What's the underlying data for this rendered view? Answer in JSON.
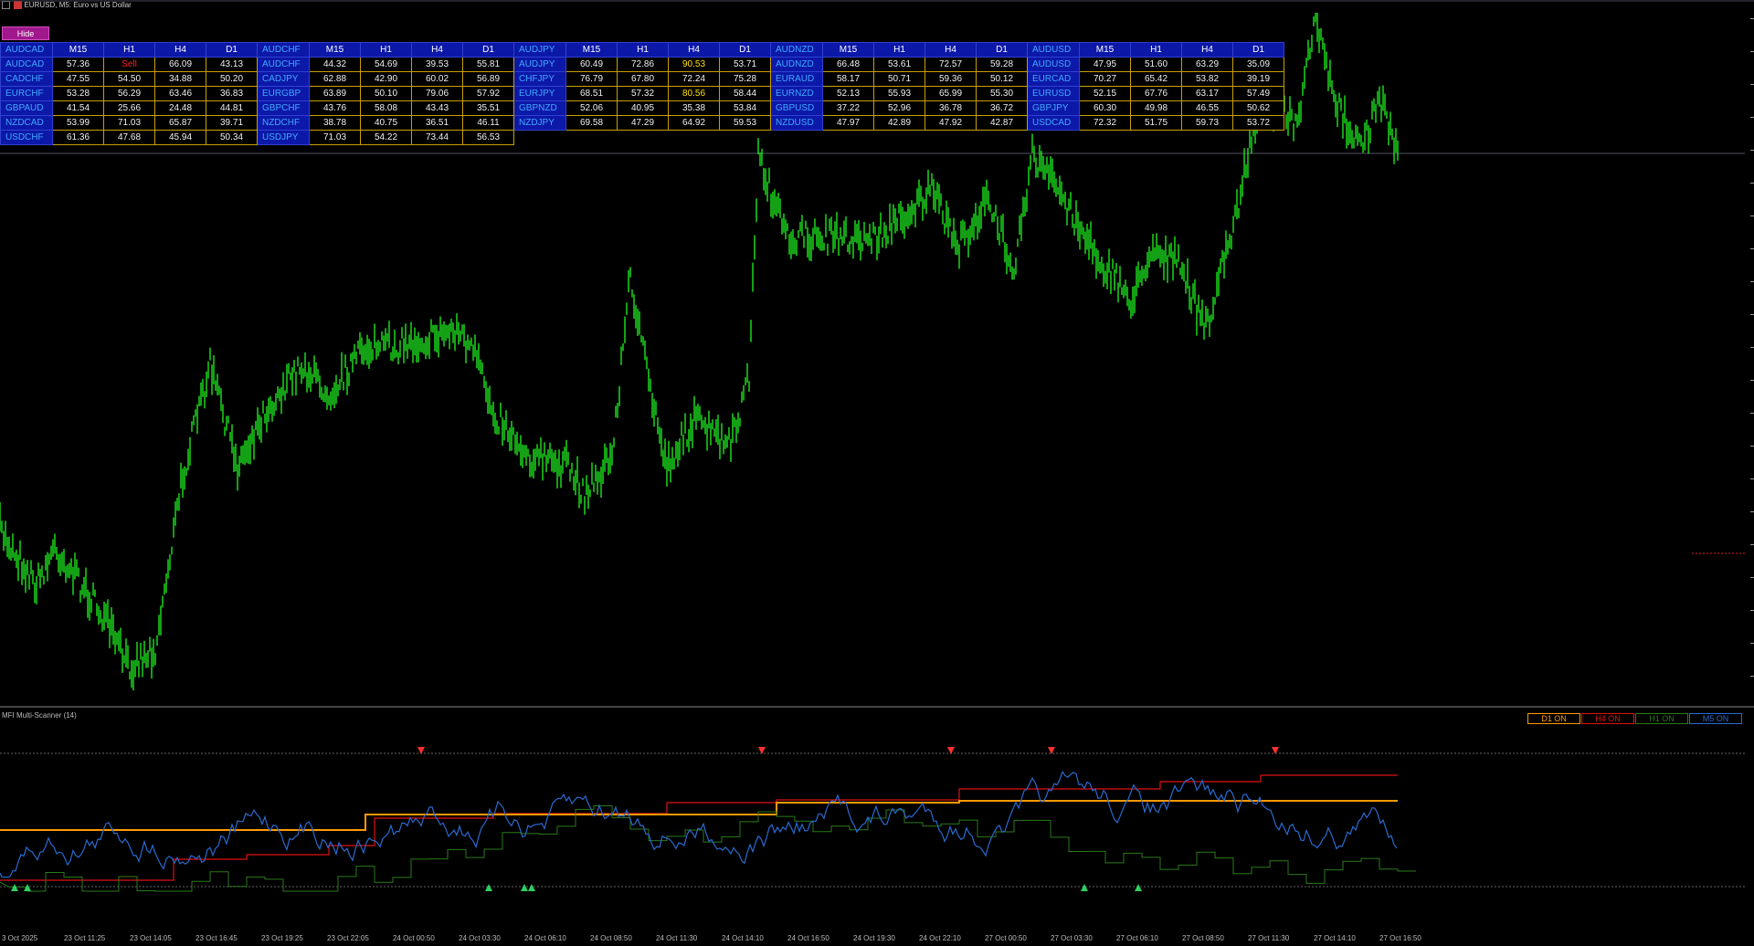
{
  "window": {
    "title": "EURUSD, M5:  Euro vs US Dollar"
  },
  "hide_button": {
    "label": "Hide"
  },
  "scanner": {
    "header_row": [
      [
        "AUDCAD",
        "M15",
        "H1",
        "H4",
        "D1"
      ],
      [
        "AUDCHF",
        "M15",
        "H1",
        "H4",
        "D1"
      ],
      [
        "AUDJPY",
        "M15",
        "H1",
        "H4",
        "D1"
      ],
      [
        "AUDNZD",
        "M15",
        "H1",
        "H4",
        "D1"
      ],
      [
        "AUDUSD",
        "M15",
        "H1",
        "H4",
        "D1"
      ]
    ],
    "rows": [
      [
        [
          "AUDCAD",
          "57.36",
          "Sell",
          "66.09",
          "43.13"
        ],
        [
          "AUDCHF",
          "44.32",
          "54.69",
          "39.53",
          "55.81"
        ],
        [
          "AUDJPY",
          "60.49",
          "72.86",
          "90.53",
          "53.71"
        ],
        [
          "AUDNZD",
          "66.48",
          "53.61",
          "72.57",
          "59.28"
        ],
        [
          "AUDUSD",
          "47.95",
          "51.60",
          "63.29",
          "35.09"
        ]
      ],
      [
        [
          "CADCHF",
          "47.55",
          "54.50",
          "34.88",
          "50.20"
        ],
        [
          "CADJPY",
          "62.88",
          "42.90",
          "60.02",
          "56.89"
        ],
        [
          "CHFJPY",
          "76.79",
          "67.80",
          "72.24",
          "75.28"
        ],
        [
          "EURAUD",
          "58.17",
          "50.71",
          "59.36",
          "50.12"
        ],
        [
          "EURCAD",
          "70.27",
          "65.42",
          "53.82",
          "39.19"
        ]
      ],
      [
        [
          "EURCHF",
          "53.28",
          "56.29",
          "63.46",
          "36.83"
        ],
        [
          "EURGBP",
          "63.89",
          "50.10",
          "79.06",
          "57.92"
        ],
        [
          "EURJPY",
          "68.51",
          "57.32",
          "80.56",
          "58.44"
        ],
        [
          "EURNZD",
          "52.13",
          "55.93",
          "65.99",
          "55.30"
        ],
        [
          "EURUSD",
          "52.15",
          "67.76",
          "63.17",
          "57.49"
        ]
      ],
      [
        [
          "GBPAUD",
          "41.54",
          "25.66",
          "24.48",
          "44.81"
        ],
        [
          "GBPCHF",
          "43.76",
          "58.08",
          "43.43",
          "35.51"
        ],
        [
          "GBPNZD",
          "52.06",
          "40.95",
          "35.38",
          "53.84"
        ],
        [
          "GBPUSD",
          "37.22",
          "52.96",
          "36.78",
          "36.72"
        ],
        [
          "GBPJPY",
          "60.30",
          "49.98",
          "46.55",
          "50.62"
        ]
      ],
      [
        [
          "NZDCAD",
          "53.99",
          "71.03",
          "65.87",
          "39.71"
        ],
        [
          "NZDCHF",
          "38.78",
          "40.75",
          "36.51",
          "46.11"
        ],
        [
          "NZDJPY",
          "69.58",
          "47.29",
          "64.92",
          "59.53"
        ],
        [
          "NZDUSD",
          "47.97",
          "42.89",
          "47.92",
          "42.87"
        ],
        [
          "USDCAD",
          "72.32",
          "51.75",
          "59.73",
          "53.72"
        ]
      ],
      [
        [
          "USDCHF",
          "61.36",
          "47.68",
          "45.94",
          "50.34"
        ],
        [
          "USDJPY",
          "71.03",
          "54.22",
          "73.44",
          "56.53"
        ]
      ]
    ],
    "highlight_cells": {
      "sell": [
        "0-0-2"
      ],
      "yellow": [
        "0-2-3",
        "2-2-3"
      ]
    }
  },
  "indicator": {
    "title": "MFI Multi-Scanner (14)",
    "buttons": [
      {
        "label": "D1 ON",
        "color": "#ff9a00"
      },
      {
        "label": "H4 ON",
        "color": "#e01010"
      },
      {
        "label": "H1 ON",
        "color": "#2a7a1a"
      },
      {
        "label": "M5 ON",
        "color": "#2a6ad0"
      }
    ]
  },
  "x_axis_labels": [
    "3 Oct 2025",
    "23 Oct 11:25",
    "23 Oct 14:05",
    "23 Oct 16:45",
    "23 Oct 19:25",
    "23 Oct 22:05",
    "24 Oct 00:50",
    "24 Oct 03:30",
    "24 Oct 06:10",
    "24 Oct 08:50",
    "24 Oct 11:30",
    "24 Oct 14:10",
    "24 Oct 16:50",
    "24 Oct 19:30",
    "24 Oct 22:10",
    "27 Oct 00:50",
    "27 Oct 03:30",
    "27 Oct 06:10",
    "27 Oct 08:50",
    "27 Oct 11:30",
    "27 Oct 14:10",
    "27 Oct 16:50"
  ],
  "colors": {
    "price": "#1ee61e",
    "m5": "#2a6ad0",
    "h1": "#2a7a1a",
    "h4": "#e01010",
    "d1": "#ff9a00",
    "grid_border": "#c8a000",
    "header_bg": "#0c18a8"
  }
}
